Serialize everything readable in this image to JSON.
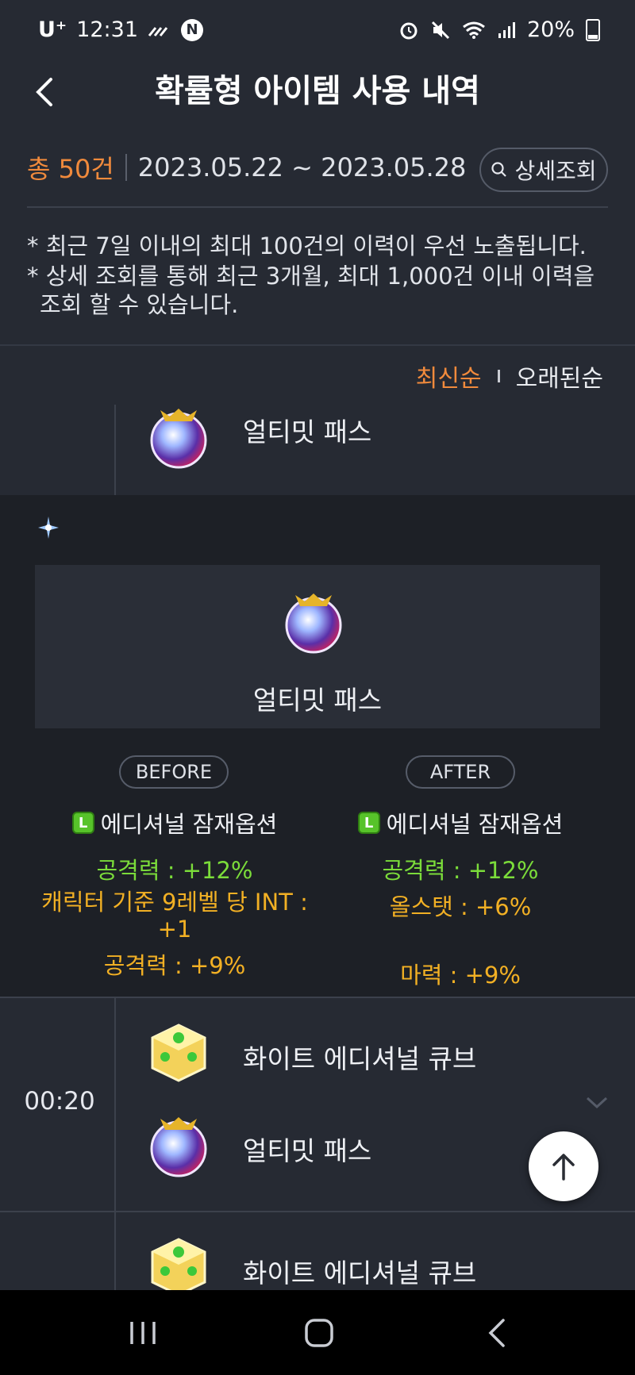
{
  "status_bar": {
    "carrier": "U⁺",
    "time": "12:31",
    "battery": "20%"
  },
  "header": {
    "title": "확률형 아이템 사용 내역"
  },
  "summary": {
    "total": "총 50건",
    "date_range": "2023.05.22 ~ 2023.05.28",
    "search_label": "상세조회"
  },
  "notes": [
    "* 최근 7일 이내의 최대 100건의 이력이 우선 노출됩니다.",
    "* 상세 조회를 통해 최근 3개월, 최대 1,000건 이내 이력을",
    "조회 할 수 있습니다."
  ],
  "sort": {
    "newest": "최신순",
    "oldest": "오래된순"
  },
  "entries": {
    "top_item": "얼티밋 패스",
    "detail": {
      "item_name": "얼티밋 패스",
      "before_label": "BEFORE",
      "after_label": "AFTER",
      "before": {
        "option_title": "에디셔널 잠재옵션",
        "lines": [
          "공격력 : +12%",
          "캐릭터 기준 9레벨 당 INT :",
          "+1",
          "공격력 : +9%"
        ]
      },
      "after": {
        "option_title": "에디셔널 잠재옵션",
        "lines": [
          "공격력 : +12%",
          "올스탯 : +6%",
          "마력 : +9%"
        ]
      }
    },
    "row2": {
      "time": "00:20",
      "item1": "화이트 에디셔널 큐브",
      "item2": "얼티밋 패스"
    },
    "row3": {
      "item1": "화이트 에디셔널 큐브"
    }
  },
  "colors": {
    "background": "#262a33",
    "accent": "#f08a3c",
    "green": "#7bdc3a",
    "orange": "#f2b024"
  }
}
